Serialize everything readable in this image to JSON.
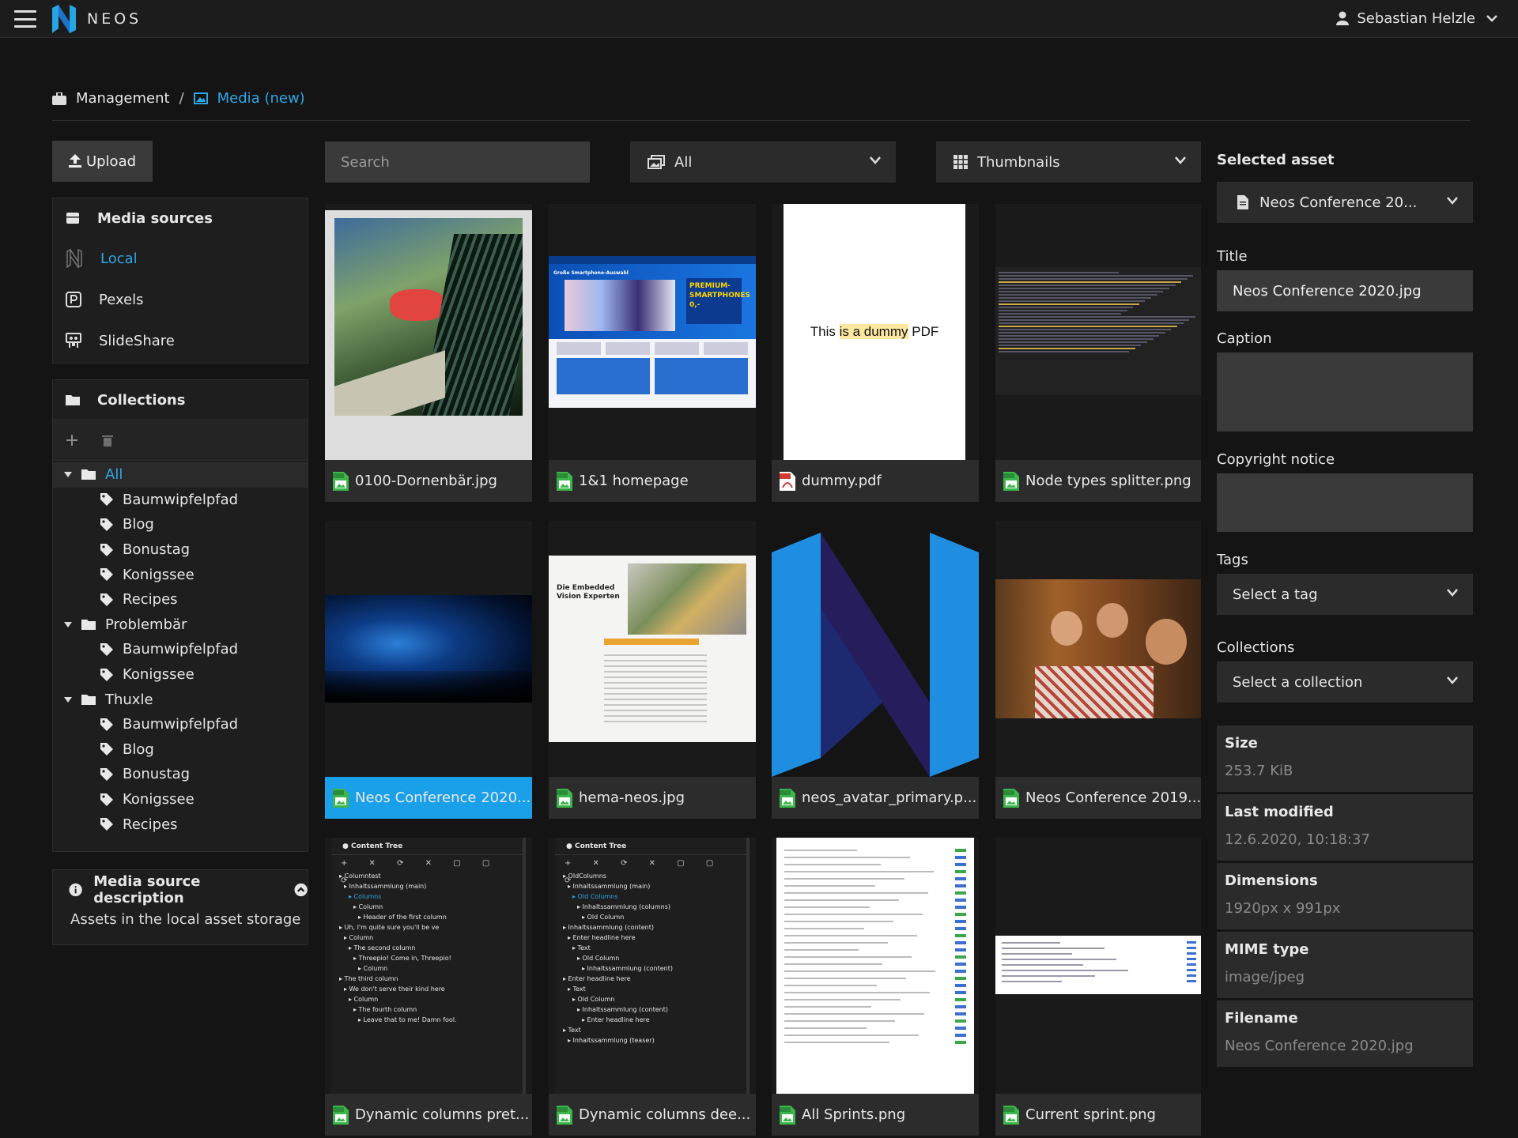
{
  "topbar": {
    "brand": "NEOS",
    "user_name": "Sebastian Helzle"
  },
  "breadcrumb": {
    "items": [
      {
        "label": "Management"
      },
      {
        "label": "Media (new)"
      }
    ],
    "separator": "/"
  },
  "toolbar": {
    "upload_label": "Upload",
    "search_placeholder": "Search",
    "type_filter_value": "All",
    "view_mode_value": "Thumbnails"
  },
  "media_sources": {
    "title": "Media sources",
    "items": [
      {
        "label": "Local",
        "icon": "neos-icon",
        "active": true
      },
      {
        "label": "Pexels",
        "icon": "pexels-icon"
      },
      {
        "label": "SlideShare",
        "icon": "slideshare-icon"
      }
    ]
  },
  "collections": {
    "title": "Collections",
    "tree": [
      {
        "label": "All",
        "children": [
          "Baumwipfelpfad",
          "Blog",
          "Bonustag",
          "Konigssee",
          "Recipes"
        ]
      },
      {
        "label": "Problembär",
        "children": [
          "Baumwipfelpfad",
          "Konigssee"
        ]
      },
      {
        "label": "Thuxle",
        "children": [
          "Baumwipfelpfad",
          "Blog",
          "Bonustag",
          "Konigssee",
          "Recipes"
        ]
      }
    ]
  },
  "source_description": {
    "title": "Media source description",
    "text": "Assets in the local asset storage"
  },
  "assets": [
    {
      "label": "0100-Dornenbär.jpg",
      "kind": "image",
      "thumb": "polaroid-garden-photo"
    },
    {
      "label": "1&1 homepage",
      "kind": "image",
      "thumb": "webshop-screenshot",
      "thumb_heading": "Große Smartphone-Auswahl",
      "thumb_badge": "PREMIUM-SMARTPHONES 0,-"
    },
    {
      "label": "dummy.pdf",
      "kind": "pdf",
      "thumb": "pdf-page",
      "thumb_text_before": "This ",
      "thumb_text_highlight": "is a dummy",
      "thumb_text_after": " PDF"
    },
    {
      "label": "Node types splitter.png",
      "kind": "image",
      "thumb": "terminal-log"
    },
    {
      "label": "Neos Conference 2020...",
      "kind": "image",
      "thumb": "concert-stage",
      "selected": true
    },
    {
      "label": "hema-neos.jpg",
      "kind": "image",
      "thumb": "article-page",
      "thumb_heading": "Die Embedded Vision Experten"
    },
    {
      "label": "neos_avatar_primary.p...",
      "kind": "image",
      "thumb": "neos-logo"
    },
    {
      "label": "Neos Conference 2019...",
      "kind": "image",
      "thumb": "group-photo"
    },
    {
      "label": "Dynamic columns pret...",
      "kind": "image",
      "thumb": "content-tree",
      "thumb_heading": "Content Tree",
      "thumb_lines": [
        "Columntest",
        "Inhaltssammlung (main)",
        "Columns",
        "Column",
        "Header of the first column",
        "Uh, I'm quite sure you'll be ve",
        "Column",
        "The second column",
        "Threepio! Come in, Threepio!",
        "Column",
        "The third column",
        "We don't serve their kind here",
        "Column",
        "The fourth column",
        "Leave that to me! Damn fool."
      ]
    },
    {
      "label": "Dynamic columns dee...",
      "kind": "image",
      "thumb": "content-tree",
      "thumb_heading": "Content Tree",
      "thumb_lines": [
        "OldColumns",
        "Inhaltssammlung (main)",
        "Old Columns",
        "Inhaltssammlung (columns)",
        "Old Column",
        "Inhaltssammlung (content)",
        "Enter headline here",
        "Text",
        "Old Column",
        "Inhaltssammlung (content)",
        "Enter headline here",
        "Text",
        "Old Column",
        "Inhaltssammlung (content)",
        "Enter headline here",
        "Text",
        "Inhaltssammlung (teaser)"
      ]
    },
    {
      "label": "All Sprints.png",
      "kind": "image",
      "thumb": "sprint-board-tall"
    },
    {
      "label": "Current sprint.png",
      "kind": "image",
      "thumb": "sprint-board-wide"
    }
  ],
  "inspector": {
    "section_title": "Selected asset",
    "selected_asset": "Neos Conference 20...",
    "title_label": "Title",
    "title_value": "Neos Conference 2020.jpg",
    "caption_label": "Caption",
    "caption_value": "",
    "copyright_label": "Copyright notice",
    "copyright_value": "",
    "tags_label": "Tags",
    "tags_placeholder": "Select a tag",
    "collections_label": "Collections",
    "collections_placeholder": "Select a collection",
    "meta": [
      {
        "key": "Size",
        "value": "253.7 KiB"
      },
      {
        "key": "Last modified",
        "value": "12.6.2020, 10:18:37"
      },
      {
        "key": "Dimensions",
        "value": "1920px x 991px"
      },
      {
        "key": "MIME type",
        "value": "image/jpeg"
      },
      {
        "key": "Filename",
        "value": "Neos Conference 2020.jpg"
      }
    ]
  },
  "colors": {
    "accent": "#2ea6e6",
    "selected_tile": "#1aa0e8",
    "background": "#141414",
    "panel": "#1e1e1e",
    "image_icon": "#3cb54a",
    "pdf_icon": "#d23b2f"
  }
}
